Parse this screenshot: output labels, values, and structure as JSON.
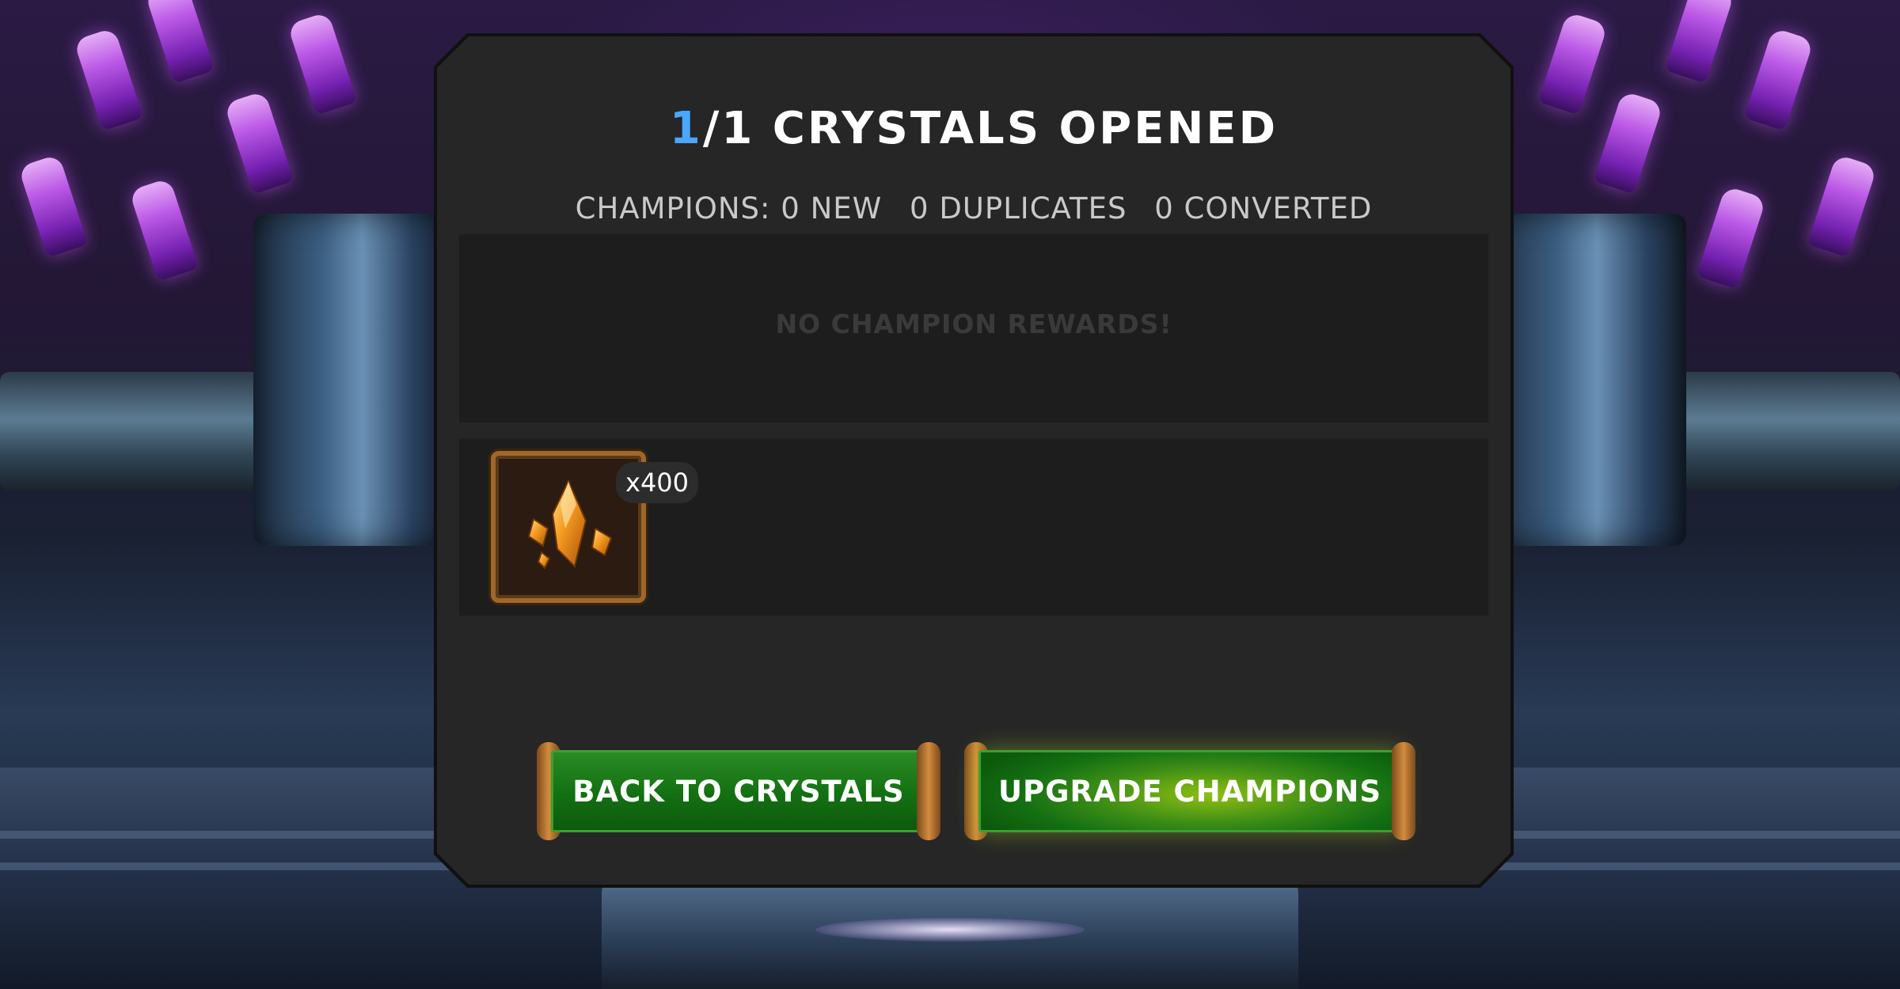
{
  "header": {
    "opened_count": "1",
    "opened_rest": "/1 CRYSTALS OPENED"
  },
  "summary": {
    "label": "CHAMPIONS:",
    "new_count": "0",
    "new_label": "NEW",
    "duplicates_count": "0",
    "duplicates_label": "DUPLICATES",
    "converted_count": "0",
    "converted_label": "CONVERTED"
  },
  "champion_rewards": {
    "empty_text": "NO CHAMPION REWARDS!"
  },
  "item_rewards": [
    {
      "icon": "shard-crystal-icon",
      "quantity": "x400"
    }
  ],
  "buttons": {
    "back": "BACK TO CRYSTALS",
    "upgrade": "UPGRADE CHAMPIONS"
  },
  "colors": {
    "accent": "#4aa6ff",
    "panel": "#262626",
    "button_green": "#137012"
  }
}
